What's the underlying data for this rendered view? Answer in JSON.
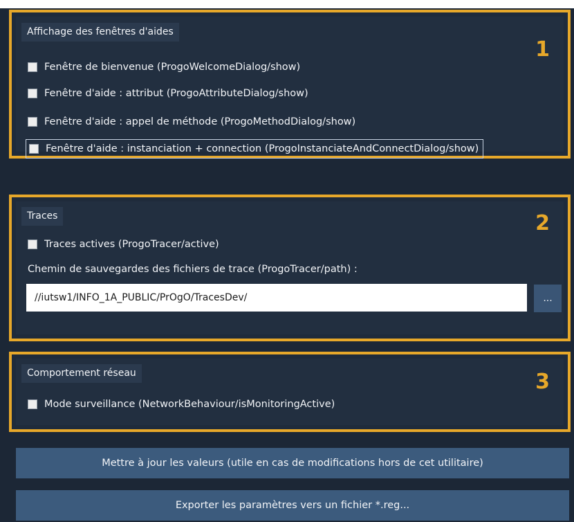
{
  "sections": [
    {
      "title": "Affichage des fenêtres d'aides",
      "number": "1",
      "checkboxes": [
        {
          "label": "Fenêtre de bienvenue (ProgoWelcomeDialog/show)",
          "checked": false
        },
        {
          "label": "Fenêtre d'aide : attribut (ProgoAttributeDialog/show)",
          "checked": false
        },
        {
          "label": "Fenêtre d'aide : appel de méthode (ProgoMethodDialog/show)",
          "checked": false
        },
        {
          "label": "Fenêtre d'aide : instanciation + connection (ProgoInstanciateAndConnectDialog/show)",
          "checked": false,
          "focused": true
        }
      ]
    },
    {
      "title": "Traces",
      "number": "2",
      "checkboxes": [
        {
          "label": "Traces actives (ProgoTracer/active)",
          "checked": false
        }
      ],
      "path_label": "Chemin de sauvegardes des fichiers de trace (ProgoTracer/path) :",
      "path_value": "//iutsw1/INFO_1A_PUBLIC/PrOgO/TracesDev/",
      "browse_label": "..."
    },
    {
      "title": "Comportement réseau",
      "number": "3",
      "checkboxes": [
        {
          "label": "Mode surveillance (NetworkBehaviour/isMonitoringActive)",
          "checked": false
        }
      ]
    }
  ],
  "buttons": {
    "update": "Mettre à jour les valeurs (utile en cas de modifications hors de cet utilitaire)",
    "export": "Exporter les paramètres vers un fichier *.reg..."
  },
  "colors": {
    "highlight_border": "#e7a82a",
    "background": "#1c2736",
    "button": "#3c5b7d"
  }
}
